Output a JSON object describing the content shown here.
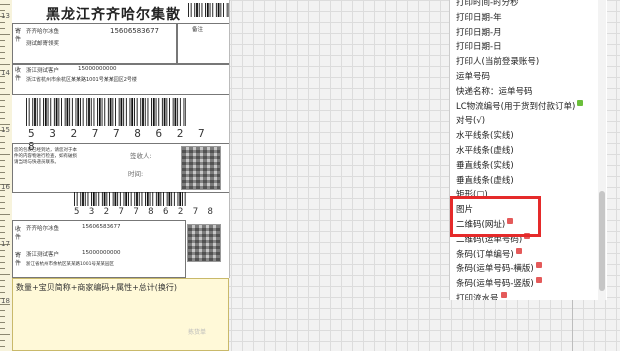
{
  "label": {
    "title": "黑龙江齐齐哈尔集散",
    "sender_side": "寄件",
    "receiver_side": "收件",
    "sender_name": "齐齐哈尔冰鱼",
    "sender_phone": "15606583677",
    "sender_addr": "测试邮寄领奖",
    "remark_head": "备注",
    "receiver_name": "浙江测试客户",
    "receiver_phone": "15000000000",
    "receiver_addr": "浙江省杭州市余杭区某某路1001号某某园区2号楼",
    "barcode_number": "5 3 2 7 7 8 6 2 7 8",
    "small_barcode_number": "5 3 2 7 7 8 6 2 7 8",
    "disclaimer": "您的包裹已经到达，请您对于本件的内容物进行检查，如有破损请当场与快递员联系。",
    "sign_label": "签收人:",
    "time_label": "时间:",
    "lower_sender_side": "寄件",
    "lower_receiver_side": "收件",
    "lower_receiver_name": "齐齐哈尔冰鱼",
    "lower_receiver_phone": "15606583677",
    "lower_sender_name": "浙江测试客户",
    "lower_sender_phone": "15000000000",
    "lower_addr": "浙江省杭州市余杭区某某路1001号某某园区"
  },
  "notes": {
    "content": "数量+宝贝简称+商家编码+属性+总计(换行)",
    "watermark": "拣货单"
  },
  "ruler": {
    "numbers": [
      "13",
      "14",
      "15",
      "16",
      "17",
      "18"
    ]
  },
  "field_list": {
    "items": [
      {
        "label": "打印时间-时分秒",
        "badge": ""
      },
      {
        "label": "打印日期-年",
        "badge": ""
      },
      {
        "label": "打印日期-月",
        "badge": ""
      },
      {
        "label": "打印日期-日",
        "badge": ""
      },
      {
        "label": "打印人(当前登录账号)",
        "badge": ""
      },
      {
        "label": "运单号码",
        "badge": ""
      },
      {
        "label": "快递名称：运单号码",
        "badge": ""
      },
      {
        "label": "LC物流编号(用于货到付款订单)",
        "badge": "green"
      },
      {
        "label": "对号(√)",
        "badge": ""
      },
      {
        "label": "水平线条(实线)",
        "badge": ""
      },
      {
        "label": "水平线条(虚线)",
        "badge": ""
      },
      {
        "label": "垂直线条(实线)",
        "badge": ""
      },
      {
        "label": "垂直线条(虚线)",
        "badge": ""
      },
      {
        "label": "矩形(□)",
        "badge": ""
      },
      {
        "label": "图片",
        "badge": ""
      },
      {
        "label": "二维码(网址)",
        "badge": "red"
      },
      {
        "label": "二维码(运单号码)",
        "badge": "red"
      },
      {
        "label": "条码(订单编号)",
        "badge": "red"
      },
      {
        "label": "条码(运单号码-横版)",
        "badge": "red"
      },
      {
        "label": "条码(运单号码-竖版)",
        "badge": "red"
      },
      {
        "label": "打印流水号",
        "badge": "red"
      }
    ]
  },
  "colors": {
    "highlight": "#e52a2a",
    "new_badge": "#6bbf3a",
    "hot_badge": "#e45a5a"
  }
}
